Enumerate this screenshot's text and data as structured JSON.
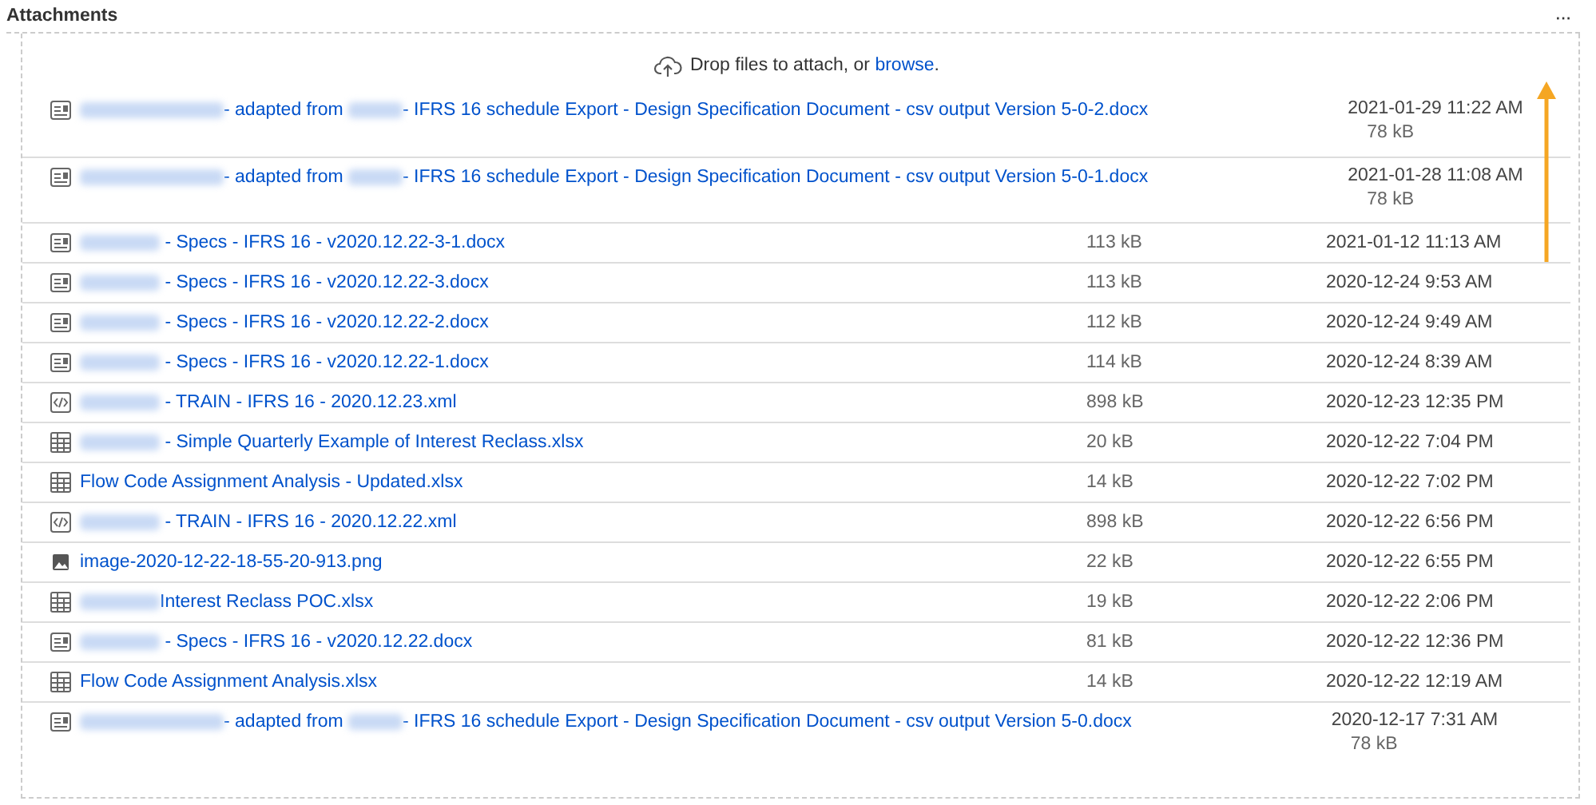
{
  "header": {
    "title": "Attachments",
    "menu": "···"
  },
  "dropzone": {
    "text": "Drop files to attach, or ",
    "link": "browse",
    "end": "."
  },
  "files": [
    {
      "kind": "doc",
      "segments": [
        {
          "kind": "redacted-long"
        },
        {
          "kind": "text",
          "text": "- adapted from "
        },
        {
          "kind": "redacted-short"
        },
        {
          "kind": "text",
          "text": "- IFRS 16 schedule Export - Design Specification Document - csv output Version 5-0-2.docx"
        }
      ],
      "size": "78 kB",
      "date": "2021-01-29 11:22 AM"
    },
    {
      "kind": "doc",
      "segments": [
        {
          "kind": "redacted-long"
        },
        {
          "kind": "text",
          "text": "- adapted from "
        },
        {
          "kind": "redacted-short"
        },
        {
          "kind": "text",
          "text": "- IFRS 16 schedule Export - Design Specification Document - csv output Version 5-0-1.docx"
        }
      ],
      "size": "78 kB",
      "date": "2021-01-28 11:08 AM"
    },
    {
      "kind": "doc",
      "segments": [
        {
          "kind": "redacted-mid"
        },
        {
          "kind": "text",
          "text": " - Specs - IFRS 16 - v2020.12.22-3-1.docx"
        }
      ],
      "size": "113 kB",
      "date": "2021-01-12 11:13 AM"
    },
    {
      "kind": "doc",
      "segments": [
        {
          "kind": "redacted-mid"
        },
        {
          "kind": "text",
          "text": " - Specs - IFRS 16 - v2020.12.22-3.docx"
        }
      ],
      "size": "113 kB",
      "date": "2020-12-24 9:53 AM"
    },
    {
      "kind": "doc",
      "segments": [
        {
          "kind": "redacted-mid"
        },
        {
          "kind": "text",
          "text": " - Specs - IFRS 16 - v2020.12.22-2.docx"
        }
      ],
      "size": "112 kB",
      "date": "2020-12-24 9:49 AM"
    },
    {
      "kind": "doc",
      "segments": [
        {
          "kind": "redacted-mid"
        },
        {
          "kind": "text",
          "text": " - Specs - IFRS 16 - v2020.12.22-1.docx"
        }
      ],
      "size": "114 kB",
      "date": "2020-12-24 8:39 AM"
    },
    {
      "kind": "code",
      "segments": [
        {
          "kind": "redacted-mid"
        },
        {
          "kind": "text",
          "text": " - TRAIN - IFRS 16 - 2020.12.23.xml"
        }
      ],
      "size": "898 kB",
      "date": "2020-12-23 12:35 PM"
    },
    {
      "kind": "sheet",
      "segments": [
        {
          "kind": "redacted-mid"
        },
        {
          "kind": "text",
          "text": " - Simple Quarterly Example of Interest Reclass.xlsx"
        }
      ],
      "size": "20 kB",
      "date": "2020-12-22 7:04 PM"
    },
    {
      "kind": "sheet",
      "segments": [
        {
          "kind": "text",
          "text": "Flow Code Assignment Analysis - Updated.xlsx"
        }
      ],
      "size": "14 kB",
      "date": "2020-12-22 7:02 PM"
    },
    {
      "kind": "code",
      "segments": [
        {
          "kind": "redacted-mid"
        },
        {
          "kind": "text",
          "text": " - TRAIN - IFRS 16 - 2020.12.22.xml"
        }
      ],
      "size": "898 kB",
      "date": "2020-12-22 6:56 PM"
    },
    {
      "kind": "image",
      "segments": [
        {
          "kind": "text",
          "text": "image-2020-12-22-18-55-20-913.png"
        }
      ],
      "size": "22 kB",
      "date": "2020-12-22 6:55 PM"
    },
    {
      "kind": "sheet",
      "segments": [
        {
          "kind": "redacted-mid"
        },
        {
          "kind": "text",
          "text": "Interest Reclass POC.xlsx"
        }
      ],
      "size": "19 kB",
      "date": "2020-12-22 2:06 PM"
    },
    {
      "kind": "doc",
      "segments": [
        {
          "kind": "redacted-mid"
        },
        {
          "kind": "text",
          "text": " - Specs - IFRS 16 - v2020.12.22.docx"
        }
      ],
      "size": "81 kB",
      "date": "2020-12-22 12:36 PM"
    },
    {
      "kind": "sheet",
      "segments": [
        {
          "kind": "text",
          "text": "Flow Code Assignment Analysis.xlsx"
        }
      ],
      "size": "14 kB",
      "date": "2020-12-22 12:19 AM"
    },
    {
      "kind": "doc",
      "segments": [
        {
          "kind": "redacted-long"
        },
        {
          "kind": "text",
          "text": "- adapted from "
        },
        {
          "kind": "redacted-short"
        },
        {
          "kind": "text",
          "text": "- IFRS 16 schedule Export - Design Specification Document - csv output Version 5-0.docx"
        }
      ],
      "size": "78 kB",
      "date": "2020-12-17 7:31 AM"
    }
  ]
}
